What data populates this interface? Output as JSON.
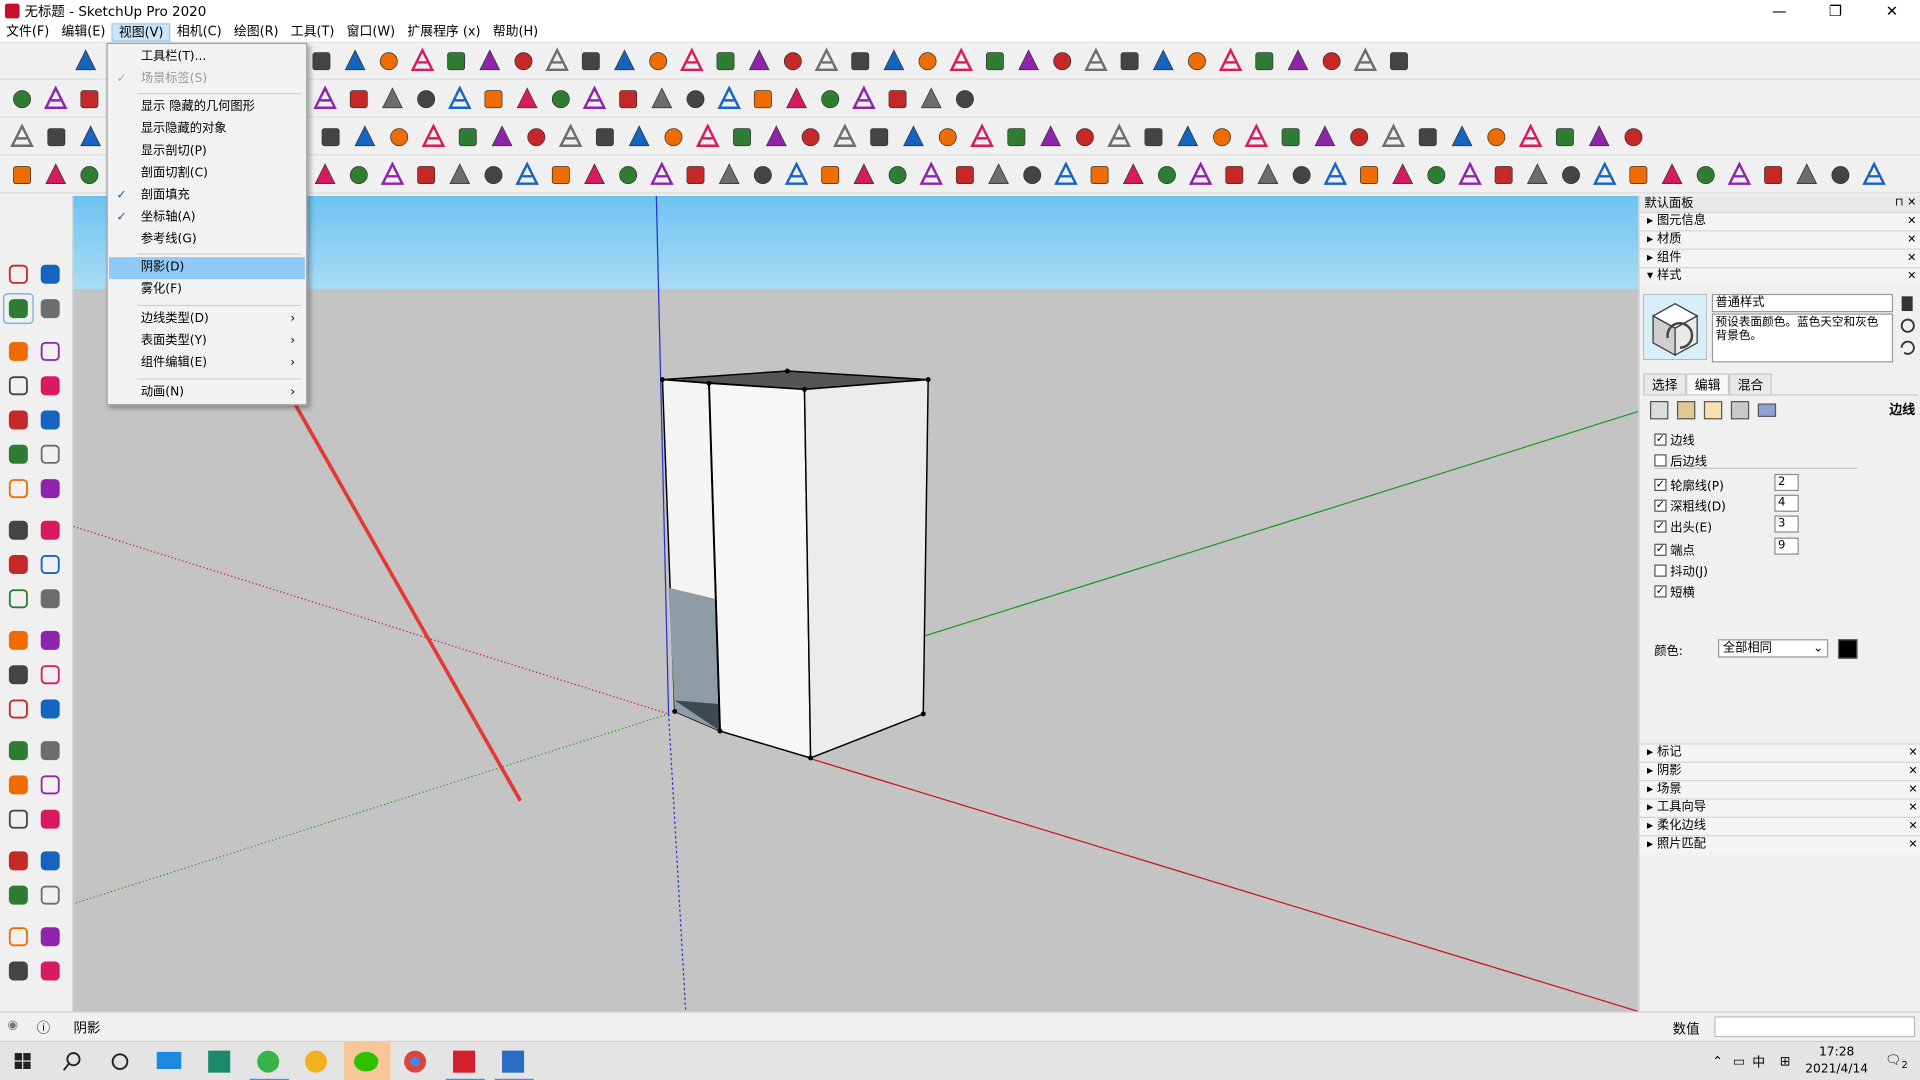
{
  "window": {
    "title": "无标题 - SketchUp Pro 2020",
    "minimize": "—",
    "maximize": "❐",
    "close": "✕"
  },
  "menubar": [
    "文件(F)",
    "编辑(E)",
    "视图(V)",
    "相机(C)",
    "绘图(R)",
    "工具(T)",
    "窗口(W)",
    "扩展程序 (x)",
    "帮助(H)"
  ],
  "view_menu": {
    "items": [
      {
        "label": "工具栏(T)...",
        "state": "normal"
      },
      {
        "label": "场景标签(S)",
        "state": "disabled",
        "checked": true
      },
      {
        "label": "显示 隐藏的几何图形",
        "state": "normal"
      },
      {
        "label": "显示隐藏的对象",
        "state": "normal"
      },
      {
        "label": "显示剖切(P)",
        "state": "normal"
      },
      {
        "label": "剖面切割(C)",
        "state": "normal"
      },
      {
        "label": "剖面填充",
        "state": "normal",
        "checked": true
      },
      {
        "label": "坐标轴(A)",
        "state": "normal",
        "checked": true
      },
      {
        "label": "参考线(G)",
        "state": "normal"
      },
      {
        "label": "阴影(D)",
        "state": "highlighted"
      },
      {
        "label": "雾化(F)",
        "state": "normal"
      },
      {
        "label": "边线类型(D)",
        "state": "normal",
        "submenu": true
      },
      {
        "label": "表面类型(Y)",
        "state": "normal",
        "submenu": true
      },
      {
        "label": "组件编辑(E)",
        "state": "normal",
        "submenu": true
      },
      {
        "label": "动画(N)",
        "state": "normal",
        "submenu": true
      }
    ]
  },
  "panel": {
    "title": "默认面板",
    "sections_top": [
      "图元信息",
      "材质",
      "组件"
    ],
    "styles_section": "样式",
    "style_name": "普通样式",
    "style_desc": "预设表面颜色。蓝色天空和灰色背景色。",
    "tabs": [
      "选择",
      "编辑",
      "混合"
    ],
    "edit_heading": "边线",
    "options": [
      {
        "label": "边线",
        "checked": true
      },
      {
        "label": "后边线",
        "checked": false
      },
      {
        "label": "轮廓线(P)",
        "checked": true,
        "value": "2"
      },
      {
        "label": "深粗线(D)",
        "checked": true,
        "value": "4"
      },
      {
        "label": "出头(E)",
        "checked": true,
        "value": "3"
      },
      {
        "label": "端点",
        "checked": true,
        "value": "9"
      },
      {
        "label": "抖动(J)",
        "checked": false
      },
      {
        "label": "短横",
        "checked": true
      }
    ],
    "color_label": "颜色:",
    "color_value": "全部相同",
    "sections_bottom": [
      "标记",
      "阴影",
      "场景",
      "工具向导",
      "柔化边线",
      "照片匹配"
    ]
  },
  "statusbar": {
    "hint": "阴影",
    "measure_label": "数值"
  },
  "taskbar": {
    "time": "17:28",
    "date": "2021/4/14",
    "ime": "中",
    "notif_count": "2"
  },
  "colors": {
    "sky": "#7ac8f2",
    "ground": "#c4c4c4",
    "axis_red": "#d11",
    "axis_green": "#1a1",
    "axis_blue": "#22c",
    "arrow": "#e53935",
    "menu_highlight": "#91c9f7"
  }
}
